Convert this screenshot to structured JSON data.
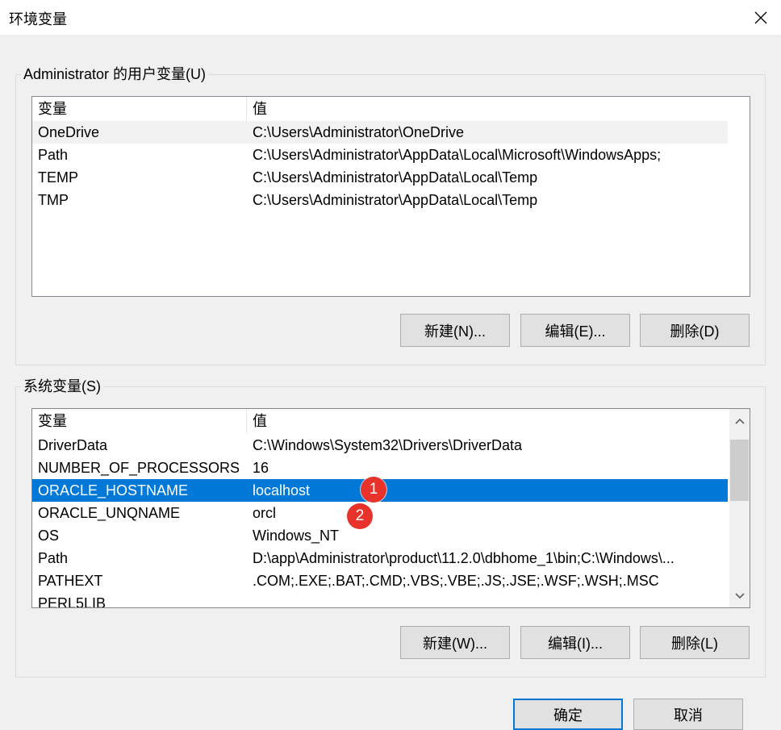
{
  "window": {
    "title": "环境变量"
  },
  "user_vars": {
    "group_label": "Administrator 的用户变量(U)",
    "columns": {
      "name": "变量",
      "value": "值"
    },
    "rows": [
      {
        "name": "OneDrive",
        "value": "C:\\Users\\Administrator\\OneDrive"
      },
      {
        "name": "Path",
        "value": "C:\\Users\\Administrator\\AppData\\Local\\Microsoft\\WindowsApps;"
      },
      {
        "name": "TEMP",
        "value": "C:\\Users\\Administrator\\AppData\\Local\\Temp"
      },
      {
        "name": "TMP",
        "value": "C:\\Users\\Administrator\\AppData\\Local\\Temp"
      }
    ],
    "buttons": {
      "new": "新建(N)...",
      "edit": "编辑(E)...",
      "delete": "删除(D)"
    }
  },
  "system_vars": {
    "group_label": "系统变量(S)",
    "columns": {
      "name": "变量",
      "value": "值"
    },
    "rows": [
      {
        "name": "DriverData",
        "value": "C:\\Windows\\System32\\Drivers\\DriverData"
      },
      {
        "name": "NUMBER_OF_PROCESSORS",
        "value": "16"
      },
      {
        "name": "ORACLE_HOSTNAME",
        "value": "localhost"
      },
      {
        "name": "ORACLE_UNQNAME",
        "value": "orcl"
      },
      {
        "name": "OS",
        "value": "Windows_NT"
      },
      {
        "name": "Path",
        "value": "D:\\app\\Administrator\\product\\11.2.0\\dbhome_1\\bin;C:\\Windows\\..."
      },
      {
        "name": "PATHEXT",
        "value": ".COM;.EXE;.BAT;.CMD;.VBS;.VBE;.JS;.JSE;.WSF;.WSH;.MSC"
      },
      {
        "name": "PERL5LIB",
        "value": ""
      }
    ],
    "buttons": {
      "new": "新建(W)...",
      "edit": "编辑(I)...",
      "delete": "删除(L)"
    }
  },
  "annotations": {
    "badge1": "1",
    "badge2": "2"
  },
  "dialog_buttons": {
    "ok": "确定",
    "cancel": "取消"
  },
  "colors": {
    "selection": "#0078d7",
    "badge": "#e8322c"
  },
  "icons": {
    "close": "close-icon",
    "scroll_up": "chevron-up-icon",
    "scroll_down": "chevron-down-icon"
  }
}
